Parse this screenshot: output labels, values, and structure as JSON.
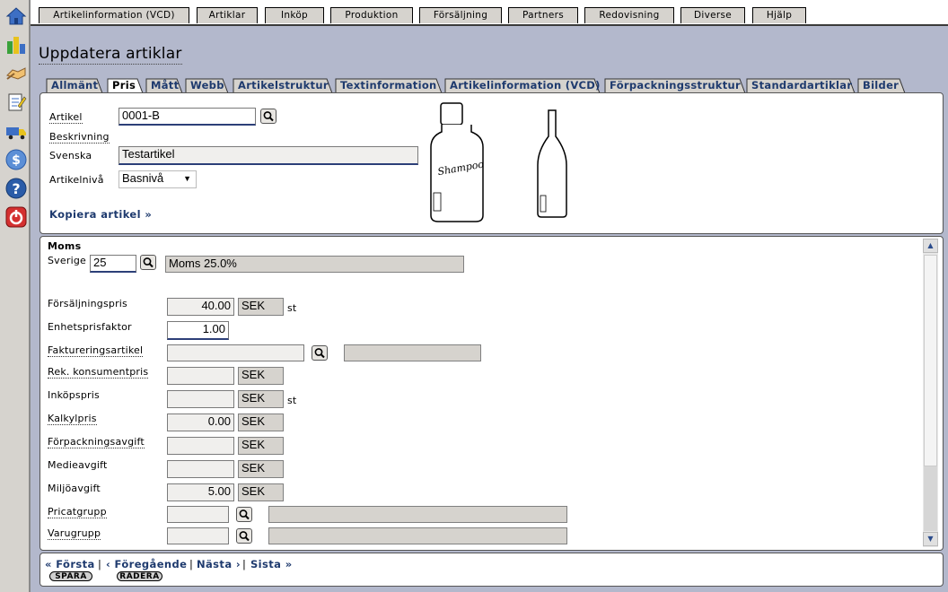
{
  "menu": [
    "Artikelinformation (VCD)",
    "Artiklar",
    "Inköp",
    "Produktion",
    "Försäljning",
    "Partners",
    "Redovisning",
    "Diverse",
    "Hjälp"
  ],
  "sidebar": [
    "home-icon",
    "chart-icon",
    "handshake-icon",
    "notepad-icon",
    "truck-icon",
    "dollar-icon",
    "help-icon",
    "power-icon"
  ],
  "page_title": "Uppdatera artiklar",
  "tabs": [
    "Allmänt",
    "Pris",
    "Mått",
    "Webb",
    "Artikelstruktur",
    "Textinformation",
    "Artikelinformation (VCD)",
    "Förpackningsstruktur",
    "Standardartiklar",
    "Bilder"
  ],
  "active_tab": "Pris",
  "general": {
    "artikel_label": "Artikel",
    "artikel_value": "0001-B",
    "beskrivning_label": "Beskrivning",
    "svenska_label": "Svenska",
    "svenska_value": "Testartikel",
    "artikelniva_label": "Artikelnivå",
    "artikelniva_value": "Basnivå",
    "kopiera_link": "Kopiera artikel »",
    "bottle_text": "Shampoo"
  },
  "moms": {
    "heading": "Moms",
    "country_label": "Sverige",
    "code": "25",
    "description": "Moms 25.0%"
  },
  "fields": {
    "forsaljningspris": {
      "label": "Försäljningspris",
      "value": "40.00",
      "currency": "SEK",
      "unit": "st"
    },
    "enhetsprisfaktor": {
      "label": "Enhetsprisfaktor",
      "value": "1.00"
    },
    "faktureringsartikel": {
      "label": "Faktureringsartikel",
      "value": "",
      "desc": ""
    },
    "rek_konsumentpris": {
      "label": "Rek. konsumentpris",
      "value": "",
      "currency": "SEK"
    },
    "inkopspris": {
      "label": "Inköpspris",
      "value": "",
      "currency": "SEK",
      "unit": "st"
    },
    "kalkylpris": {
      "label": "Kalkylpris",
      "value": "0.00",
      "currency": "SEK"
    },
    "forpackningsavgift": {
      "label": "Förpackningsavgift",
      "value": "",
      "currency": "SEK"
    },
    "medieavgift": {
      "label": "Medieavgift",
      "value": "",
      "currency": "SEK"
    },
    "miljoavgift": {
      "label": "Miljöavgift",
      "value": "5.00",
      "currency": "SEK"
    },
    "pricatgrupp": {
      "label": "Pricatgrupp",
      "value": "",
      "desc": ""
    },
    "varugrupp": {
      "label": "Varugrupp",
      "value": "",
      "desc": ""
    }
  },
  "nav": {
    "forsta": "« Första",
    "foregaende": "‹ Föregående",
    "nasta": "Nästa ›",
    "sista": "Sista »",
    "sep": "|"
  },
  "buttons": {
    "spara": "SPARA",
    "radera": "RADERA"
  },
  "colors": {
    "link": "#1e3a6e",
    "background": "#b3b8cc",
    "focus_border": "#2c3f78"
  }
}
